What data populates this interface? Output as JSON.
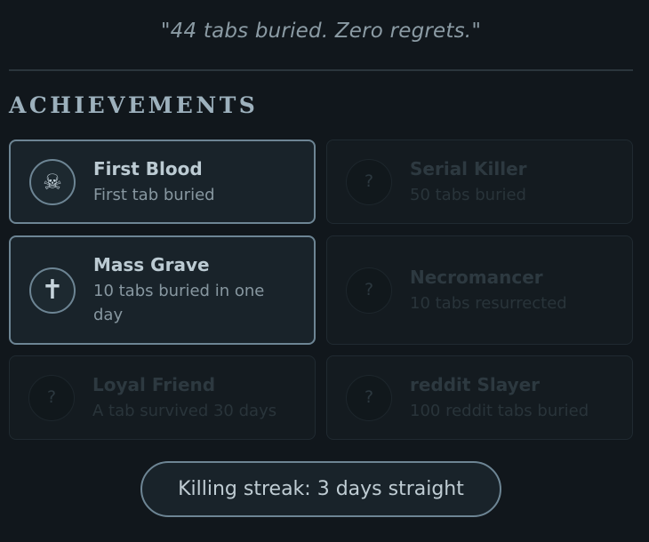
{
  "quote": "\"44 tabs buried. Zero regrets.\"",
  "achievements_title": "ACHIEVEMENTS",
  "achievements": [
    {
      "title": "First Blood",
      "description": "First tab buried",
      "unlocked": true,
      "icon": "skull-crossbones-icon",
      "glyph": "☠"
    },
    {
      "title": "Serial Killer",
      "description": "50 tabs buried",
      "unlocked": false,
      "icon": "question-mark-icon",
      "glyph": "?"
    },
    {
      "title": "Mass Grave",
      "description": "10 tabs buried in one day",
      "unlocked": true,
      "icon": "cross-icon",
      "glyph": "✝"
    },
    {
      "title": "Necromancer",
      "description": "10 tabs resurrected",
      "unlocked": false,
      "icon": "question-mark-icon",
      "glyph": "?"
    },
    {
      "title": "Loyal Friend",
      "description": "A tab survived 30 days",
      "unlocked": false,
      "icon": "question-mark-icon",
      "glyph": "?"
    },
    {
      "title": "reddit Slayer",
      "description": "100 reddit tabs buried",
      "unlocked": false,
      "icon": "question-mark-icon",
      "glyph": "?"
    }
  ],
  "streak_label": "Killing streak: 3 days straight",
  "colors": {
    "background": "#11171c",
    "unlocked_border": "#6d8594",
    "locked_text": "#2d3940"
  }
}
